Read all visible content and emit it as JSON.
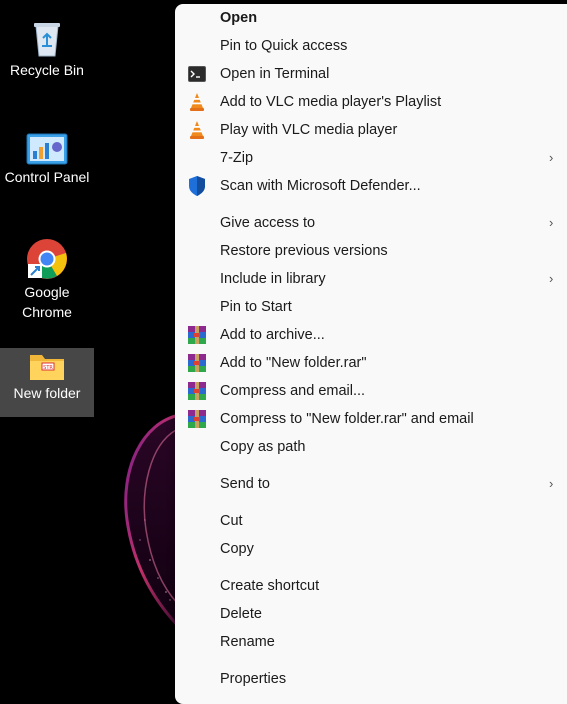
{
  "desktop": {
    "icons": [
      {
        "label_lines": [
          "Recycle Bin"
        ],
        "icon": "recycle-bin-icon"
      },
      {
        "label_lines": [
          "Control Panel"
        ],
        "icon": "control-panel-icon"
      },
      {
        "label_lines": [
          "Google",
          "Chrome"
        ],
        "icon": "chrome-icon"
      },
      {
        "label_lines": [
          "New folder"
        ],
        "icon": "folder-icon",
        "selected": true
      }
    ]
  },
  "context_menu": {
    "items": [
      {
        "label": "Open",
        "bold": true
      },
      {
        "label": "Pin to Quick access"
      },
      {
        "label": "Open in Terminal",
        "icon": "terminal-icon"
      },
      {
        "label": "Add to VLC media player's Playlist",
        "icon": "vlc-icon"
      },
      {
        "label": "Play with VLC media player",
        "icon": "vlc-icon"
      },
      {
        "label": "7-Zip",
        "submenu": true
      },
      {
        "label": "Scan with Microsoft Defender...",
        "icon": "defender-shield-icon"
      },
      {
        "label": "Give access to",
        "submenu": true
      },
      {
        "label": "Restore previous versions"
      },
      {
        "label": "Include in library",
        "submenu": true
      },
      {
        "label": "Pin to Start"
      },
      {
        "label": "Add to archive...",
        "icon": "winrar-icon"
      },
      {
        "label": "Add to \"New folder.rar\"",
        "icon": "winrar-icon"
      },
      {
        "label": "Compress and email...",
        "icon": "winrar-icon"
      },
      {
        "label": "Compress to \"New folder.rar\" and email",
        "icon": "winrar-icon"
      },
      {
        "label": "Copy as path"
      },
      {
        "label": "Send to",
        "submenu": true
      },
      {
        "label": "Cut"
      },
      {
        "label": "Copy"
      },
      {
        "label": "Create shortcut"
      },
      {
        "label": "Delete"
      },
      {
        "label": "Rename"
      },
      {
        "label": "Properties"
      }
    ],
    "submenu_glyph": "›"
  },
  "colors": {
    "menu_background": "#f9f9f9",
    "menu_text": "#1a1a1a",
    "desktop_background": "#000000",
    "selection_highlight": "#5a5a5a"
  }
}
